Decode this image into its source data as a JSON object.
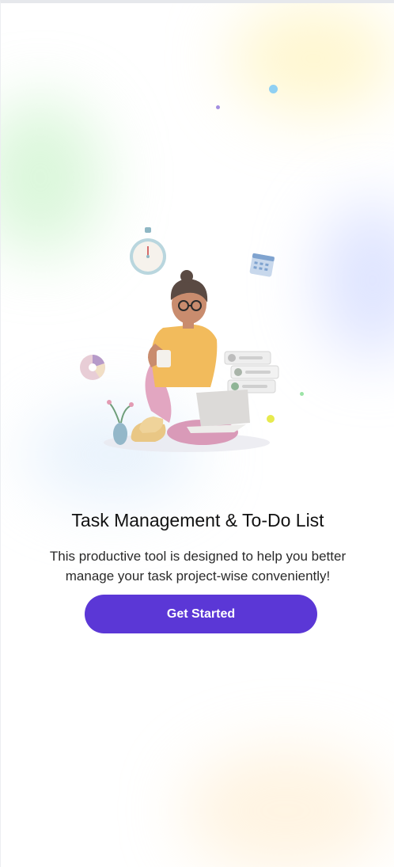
{
  "onboarding": {
    "title": "Task Management & To-Do List",
    "description": "This productive tool is designed to help you better manage your task project-wise conveniently!",
    "cta_label": "Get Started"
  },
  "colors": {
    "primary": "#5b37d6",
    "title_text": "#111111",
    "body_text": "#2a2a2a"
  },
  "illustration_icons": [
    "stopwatch-icon",
    "calendar-icon",
    "pie-chart-icon",
    "plant-vase-icon",
    "checklist-icon"
  ]
}
